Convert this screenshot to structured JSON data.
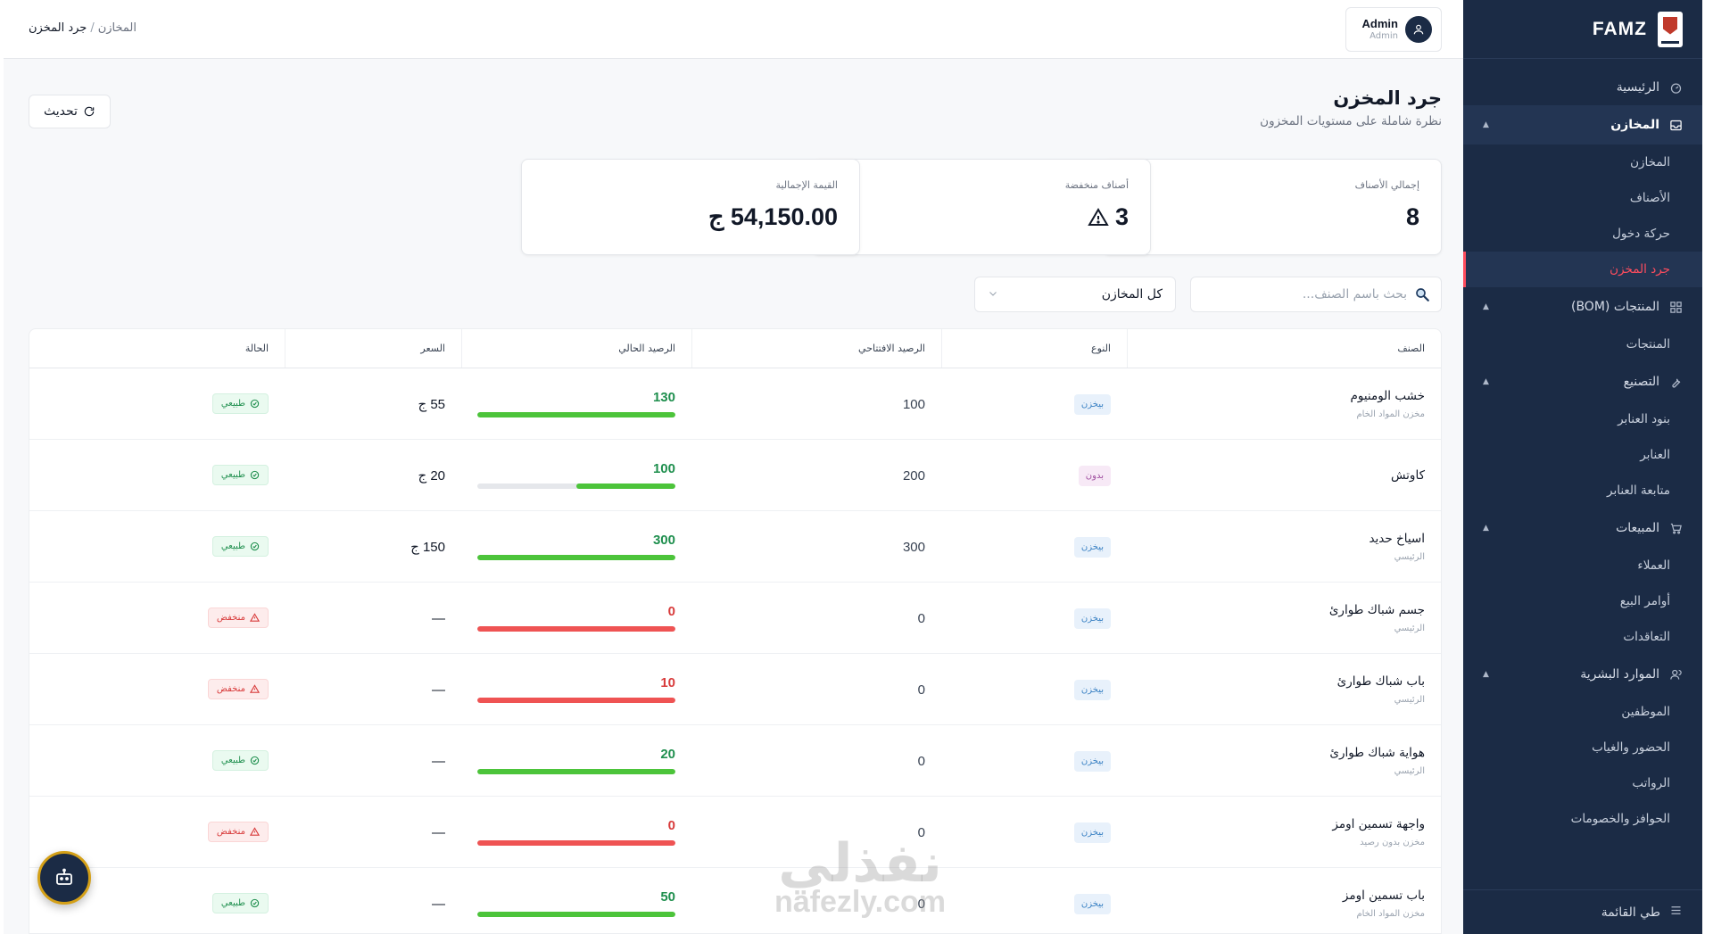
{
  "brand": {
    "name": "FAMZ"
  },
  "user": {
    "name": "Admin",
    "role": "Admin"
  },
  "breadcrumb": {
    "parent": "المخازن",
    "separator": "/",
    "current": "جرد المخزن"
  },
  "header": {
    "title": "جرد المخزن",
    "subtitle": "نظرة شاملة على مستويات المخزون",
    "refresh_label": "تحديث"
  },
  "sidebar": {
    "home": "الرئيسية",
    "warehouses": {
      "label": "المخازن",
      "items": [
        "المخازن",
        "الأصناف",
        "حركة دخول",
        "جرد المخزن"
      ]
    },
    "products": {
      "label": "المنتجات (BOM)",
      "items": [
        "المنتجات"
      ]
    },
    "manufacturing": {
      "label": "التصنيع",
      "items": [
        "بنود العنابر",
        "العنابر",
        "متابعة العنابر"
      ]
    },
    "sales": {
      "label": "المبيعات",
      "items": [
        "العملاء",
        "أوامر البيع",
        "التعاقدات"
      ]
    },
    "hr": {
      "label": "الموارد البشرية",
      "items": [
        "الموظفين",
        "الحضور والغياب",
        "الرواتب",
        "الحوافز والخصومات"
      ]
    },
    "collapse": "طي القائمة"
  },
  "stats": {
    "total_items": {
      "label": "إجمالي الأصناف",
      "value": "8"
    },
    "low_items": {
      "label": "أصناف منخفضة",
      "value": "3"
    },
    "total_value": {
      "label": "القيمة الإجمالية",
      "value": "54,150.00 ج"
    }
  },
  "filters": {
    "search_placeholder": "بحث باسم الصنف...",
    "warehouse_selected": "كل المخازن"
  },
  "table": {
    "columns": [
      "الصنف",
      "النوع",
      "الرصيد الافتتاحي",
      "الرصيد الحالي",
      "السعر",
      "الحالة"
    ],
    "rows": [
      {
        "name": "خشب الومنيوم",
        "warehouse": "مخزن المواد الخام",
        "type": "بيخزن",
        "opening": "100",
        "current": "130",
        "price": "55 ج",
        "status": "طبيعي"
      },
      {
        "name": "كاوتش",
        "warehouse": "",
        "type": "بدون",
        "opening": "200",
        "current": "100",
        "price": "20 ج",
        "status": "طبيعي"
      },
      {
        "name": "اسياخ حديد",
        "warehouse": "الرئيسي",
        "type": "بيخزن",
        "opening": "300",
        "current": "300",
        "price": "150 ج",
        "status": "طبيعي"
      },
      {
        "name": "جسم شباك طوارئ",
        "warehouse": "الرئيسي",
        "type": "بيخزن",
        "opening": "0",
        "current": "0",
        "price": "—",
        "status": "منخفض"
      },
      {
        "name": "باب شباك طوارئ",
        "warehouse": "الرئيسي",
        "type": "بيخزن",
        "opening": "0",
        "current": "10",
        "price": "—",
        "status": "منخفض"
      },
      {
        "name": "هواية شباك طوارئ",
        "warehouse": "الرئيسي",
        "type": "بيخزن",
        "opening": "0",
        "current": "20",
        "price": "—",
        "status": "طبيعي"
      },
      {
        "name": "واجهة تسمين اومز",
        "warehouse": "مخزن بدون رصيد",
        "type": "بيخزن",
        "opening": "0",
        "current": "0",
        "price": "—",
        "status": "منخفض"
      },
      {
        "name": "باب تسمين اومز",
        "warehouse": "مخزن المواد الخام",
        "type": "بيخزن",
        "opening": "0",
        "current": "50",
        "price": "—",
        "status": "طبيعي"
      }
    ],
    "bar_fill": [
      1.0,
      0.5,
      1.0,
      1.0,
      1.0,
      1.0,
      1.0,
      1.0
    ]
  },
  "watermark": {
    "ar": "نفذلي",
    "en": "nafezly.com"
  },
  "colors": {
    "sidebar": "#1b2b45",
    "accent_red": "#ff4d5e",
    "ok_green": "#1f8f4e",
    "bar_green": "#4cc43a",
    "bar_red": "#ef5353",
    "low_red": "#d83b3b"
  }
}
